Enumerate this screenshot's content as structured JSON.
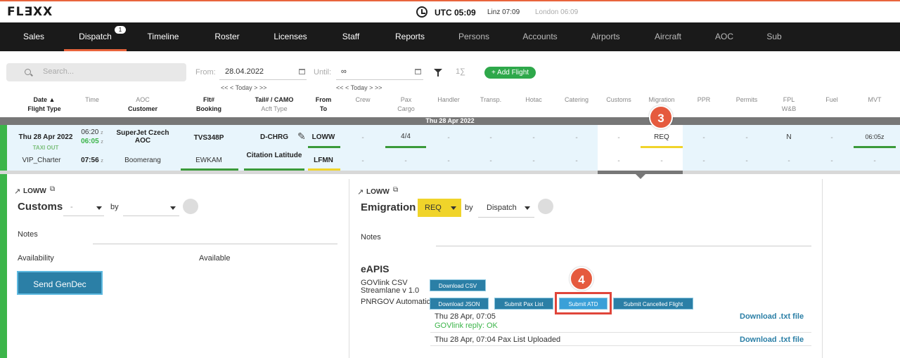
{
  "header": {
    "logo": "FL∃XX",
    "utc": "UTC 05:09",
    "linz": "Linz 07:09",
    "london": "London 06:09"
  },
  "nav": {
    "items": [
      {
        "label": "Sales"
      },
      {
        "label": "Dispatch",
        "badge": "1"
      },
      {
        "label": "Timeline"
      },
      {
        "label": "Roster"
      },
      {
        "label": "Licenses"
      },
      {
        "label": "Staff"
      },
      {
        "label": "Reports"
      },
      {
        "label": "Persons"
      },
      {
        "label": "Accounts"
      },
      {
        "label": "Airports"
      },
      {
        "label": "Aircraft"
      },
      {
        "label": "AOC"
      },
      {
        "label": "Sub"
      }
    ]
  },
  "filters": {
    "search_placeholder": "Search...",
    "from_label": "From:",
    "from_value": "28.04.2022",
    "until_label": "Until:",
    "until_value": "∞",
    "today_nav": "<< < Today > >>",
    "sigma": "1∑",
    "add_flight": "+ Add Flight"
  },
  "columns": {
    "date": "Date ▲",
    "flight_type": "Flight Type",
    "time": "Time",
    "aoc": "AOC",
    "customer": "Customer",
    "flt": "Flt#",
    "booking": "Booking",
    "tail": "Tail# / CAMO",
    "acft_type": "Acft Type",
    "from": "From",
    "to": "To",
    "crew": "Crew",
    "pax": "Pax",
    "cargo": "Cargo",
    "handler": "Handler",
    "transp": "Transp.",
    "hotac": "Hotac",
    "catering": "Catering",
    "customs": "Customs",
    "migration": "Migration",
    "ppr": "PPR",
    "permits": "Permits",
    "fpl": "FPL",
    "wb": "W&B",
    "fuel": "Fuel",
    "mvt": "MVT"
  },
  "day_bar": "Thu 28 Apr 2022",
  "flight": {
    "date": "Thu 28 Apr 2022",
    "status": "TAXI OUT",
    "flight_type": "VIP_Charter",
    "time_sched": "06:20",
    "time_actual": "06:05",
    "time_arr": "07:56",
    "tz": "z",
    "aoc": "SuperJet Czech AOC",
    "customer": "Boomerang",
    "flt": "TVS348P",
    "booking": "EWKAM",
    "tail": "D-CHRG",
    "acft_type": "Citation Latitude",
    "from": "LOWW",
    "to": "LFMN",
    "pax": "4/4",
    "migration": "REQ",
    "fpl": "N",
    "mvt": "06:05z",
    "dash": "-"
  },
  "annotations": {
    "step3": "3",
    "step4": "4"
  },
  "customs_panel": {
    "airport": "LOWW",
    "title": "Customs",
    "status_value": "-",
    "by_label": "by",
    "notes_label": "Notes",
    "availability_label": "Availability",
    "availability_value": "Available",
    "send_gendec": "Send GenDec"
  },
  "emigration_panel": {
    "airport": "LOWW",
    "title": "Emigration",
    "status_value": "REQ",
    "by_label": "by",
    "by_value": "Dispatch",
    "notes_label": "Notes",
    "eapis_title": "eAPIS",
    "govlink_label": "GOVlink CSV",
    "streamlane_label": "Streamlane v 1.0",
    "pnrgov_label": "PNRGOV Automatic",
    "download_csv": "Download CSV",
    "download_json": "Download JSON",
    "submit_pax": "Submit Pax List",
    "submit_atd": "Submit ATD",
    "submit_cancelled": "Submit Cancelled Flight",
    "log1_time": "Thu 28 Apr, 07:05",
    "log1_reply": "GOVlink reply: OK",
    "log2": "Thu 28 Apr, 07:04 Pax List Uploaded",
    "download_txt": "Download .txt file"
  }
}
